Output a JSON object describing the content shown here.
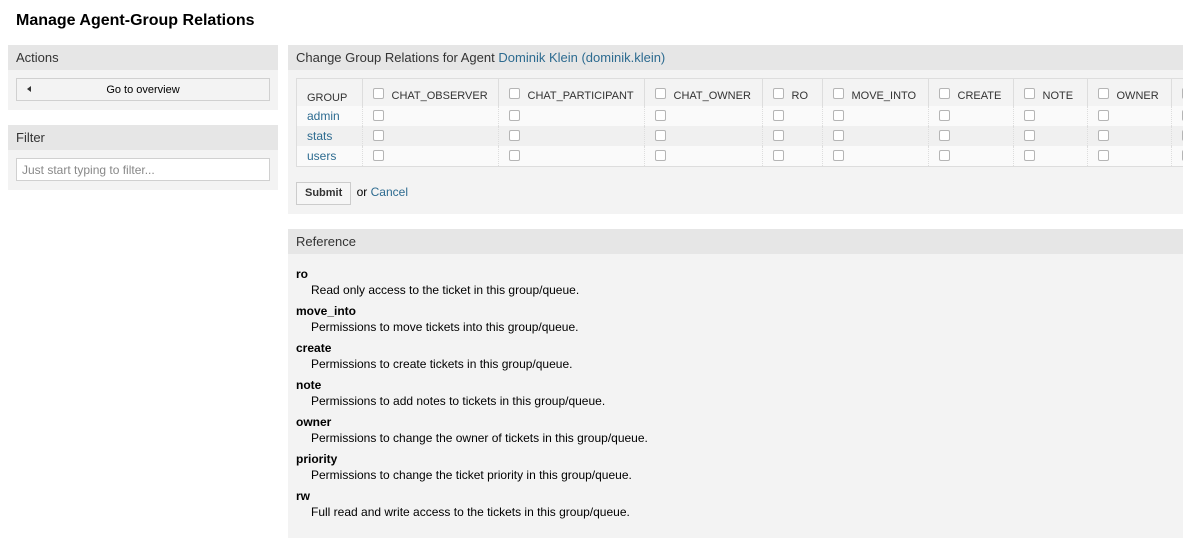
{
  "page": {
    "title": "Manage Agent-Group Relations"
  },
  "sidebar": {
    "actions": {
      "title": "Actions",
      "overview_label": "Go to overview",
      "overview_icon": "triangle-left-icon"
    },
    "filter": {
      "title": "Filter",
      "placeholder": "Just start typing to filter...",
      "value": ""
    }
  },
  "relations": {
    "header_prefix": "Change Group Relations for Agent",
    "agent_link": "Dominik Klein (dominik.klein)",
    "group_header": "GROUP",
    "columns": [
      {
        "label": "CHAT_OBSERVER",
        "checked": false
      },
      {
        "label": "CHAT_PARTICIPANT",
        "checked": false
      },
      {
        "label": "CHAT_OWNER",
        "checked": false
      },
      {
        "label": "RO",
        "checked": false
      },
      {
        "label": "MOVE_INTO",
        "checked": false
      },
      {
        "label": "CREATE",
        "checked": false
      },
      {
        "label": "NOTE",
        "checked": false
      },
      {
        "label": "OWNER",
        "checked": false
      },
      {
        "label": "",
        "checked": false
      }
    ],
    "rows": [
      {
        "group": "admin",
        "values": [
          false,
          false,
          false,
          false,
          false,
          false,
          false,
          false,
          false
        ]
      },
      {
        "group": "stats",
        "values": [
          false,
          false,
          false,
          false,
          false,
          false,
          false,
          false,
          false
        ]
      },
      {
        "group": "users",
        "values": [
          false,
          false,
          false,
          false,
          false,
          false,
          false,
          false,
          false
        ]
      }
    ],
    "submit_label": "Submit",
    "or_text": "or",
    "cancel_label": "Cancel"
  },
  "reference": {
    "title": "Reference",
    "items": [
      {
        "term": "ro",
        "description": "Read only access to the ticket in this group/queue."
      },
      {
        "term": "move_into",
        "description": "Permissions to move tickets into this group/queue."
      },
      {
        "term": "create",
        "description": "Permissions to create tickets in this group/queue."
      },
      {
        "term": "note",
        "description": "Permissions to add notes to tickets in this group/queue."
      },
      {
        "term": "owner",
        "description": "Permissions to change the owner of tickets in this group/queue."
      },
      {
        "term": "priority",
        "description": "Permissions to change the ticket priority in this group/queue."
      },
      {
        "term": "rw",
        "description": "Full read and write access to the tickets in this group/queue."
      }
    ]
  }
}
